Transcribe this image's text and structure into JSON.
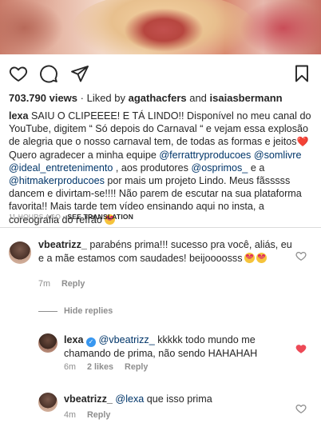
{
  "post": {
    "views_count": "703.790 views",
    "liked_by_prefix": " · Liked by ",
    "liked_by_user1": "agathacfers",
    "liked_by_and": " and ",
    "liked_by_user2": "isaiasbermann",
    "caption": {
      "username": "lexa",
      "part1": " SAIU O CLIPEEEE! E TÁ LINDO!! Disponível no meu canal do YouTube, digitem “ Só depois do Carnaval “ e vejam essa explosão de alegria que o nosso carnaval tem, de todas as formas e jeitos",
      "heart": "❤️",
      "part2": " Quero agradecer a minha equipe ",
      "mention1": "@ferrattryproducoes",
      "sep1": " ",
      "mention2": "@somlivre",
      "sep2": " ",
      "mention3": "@ideal_entretenimento",
      "part3": " , aos produtores ",
      "mention4": "@osprimos_",
      "part4": " e a ",
      "mention5": "@hitmakerproducoes",
      "part5": " por mais um projeto Lindo. Meus fãsssss dancem e divirtam-se!!!! Não parem de escutar na sua plataforma favorita!! Mais tarde tem vídeo ensinando aqui no insta, a coreografia do refrão "
    },
    "timestamp": "11 HOURS AGO",
    "timestamp_sep": " • ",
    "see_translation": "SEE TRANSLATION"
  },
  "icons": {
    "like": "heart-outline-icon",
    "comment": "comment-bubble-icon",
    "share": "paper-plane-icon",
    "save": "bookmark-icon"
  },
  "colors": {
    "mention": "#003569",
    "muted": "#8e8e8e",
    "liked_heart": "#ed4956",
    "verified": "#3897f0"
  },
  "comments": [
    {
      "username": "vbeatrizz_",
      "text": " parabéns prima!!! sucesso pra você, aliás, eu e a mãe estamos com saudades! beijoooosss",
      "time": "7m",
      "reply_label": "Reply",
      "liked": false
    },
    {
      "username": "lexa",
      "mention": "@vbeatrizz_",
      "text": " kkkkk todo mundo me chamando de prima, não sendo HAHAHAH",
      "time": "6m",
      "likes_label": "2 likes",
      "reply_label": "Reply",
      "liked": true
    },
    {
      "username": "vbeatrizz_",
      "mention": "@lexa",
      "text": " que isso prima",
      "time": "4m",
      "reply_label": "Reply",
      "liked": false
    }
  ],
  "hide_replies_label": "Hide replies"
}
